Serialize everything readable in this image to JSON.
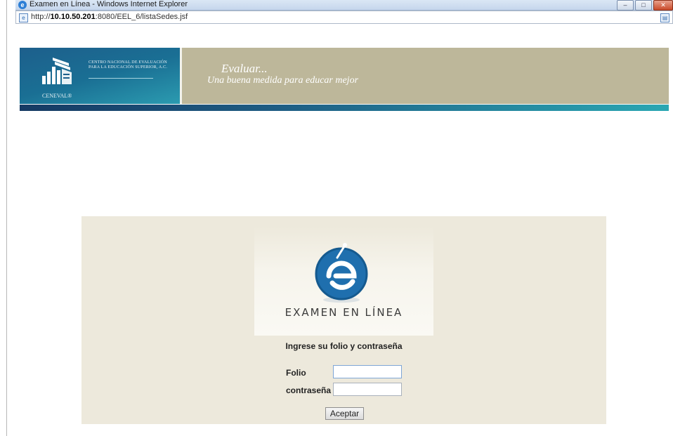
{
  "browser": {
    "window_title": "Examen en Línea - Windows Internet Explorer",
    "url_prefix": "http://",
    "url_host": "10.10.50.201",
    "url_rest": ":8080/EEL_6/listaSedes.jsf",
    "controls": [
      "minimize-icon",
      "maximize-icon",
      "close-icon"
    ]
  },
  "header": {
    "org_name": "CENTRO NACIONAL DE EVALUACIÓN PARA LA EDUCACIÓN SUPERIOR, A.C.",
    "brand": "CENEVAL®",
    "tagline_title": "Evaluar...",
    "tagline_subtitle": "Una buena medida para educar mejor"
  },
  "login": {
    "logo_text": "EXAMEN EN LÍNEA",
    "instruction": "Ingrese su folio y contraseña",
    "folio_label": "Folio",
    "folio_value": "",
    "password_label": "contraseña",
    "password_value": "",
    "submit_label": "Aceptar"
  },
  "colors": {
    "banner_blue": "#1d5f8c",
    "banner_tan": "#bdb79a",
    "panel_bg": "#ede9dc",
    "logo_blue": "#1f6fae"
  }
}
